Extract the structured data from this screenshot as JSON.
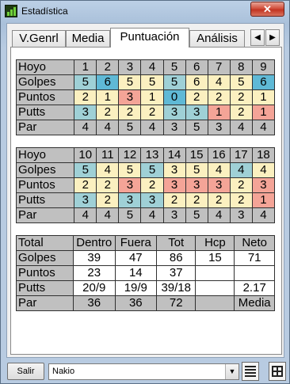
{
  "window": {
    "title": "Estadística",
    "close_symbol": "✕"
  },
  "tabs": [
    "V.Genrl",
    "Media",
    "Puntuación",
    "Análisis"
  ],
  "tab_arrows": {
    "left": "◀",
    "right": "▶"
  },
  "holes_front": {
    "rows": [
      {
        "label": "Hoyo",
        "values": [
          "1",
          "2",
          "3",
          "4",
          "5",
          "6",
          "7",
          "8",
          "9"
        ],
        "colors": [
          "gray",
          "gray",
          "gray",
          "gray",
          "gray",
          "gray",
          "gray",
          "gray",
          "gray"
        ]
      },
      {
        "label": "Golpes",
        "values": [
          "5",
          "6",
          "5",
          "5",
          "5",
          "6",
          "4",
          "5",
          "6"
        ],
        "colors": [
          "blue",
          "teal",
          "yellow",
          "yellow",
          "blue",
          "yellow",
          "yellow",
          "yellow",
          "teal"
        ]
      },
      {
        "label": "Puntos",
        "values": [
          "2",
          "1",
          "3",
          "1",
          "0",
          "2",
          "2",
          "2",
          "1"
        ],
        "colors": [
          "yellow",
          "yellow",
          "red",
          "yellow",
          "teal",
          "yellow",
          "yellow",
          "yellow",
          "yellow"
        ]
      },
      {
        "label": "Putts",
        "values": [
          "3",
          "2",
          "2",
          "2",
          "3",
          "3",
          "1",
          "2",
          "1"
        ],
        "colors": [
          "blue",
          "yellow",
          "yellow",
          "yellow",
          "blue",
          "blue",
          "red",
          "yellow",
          "red"
        ]
      },
      {
        "label": "Par",
        "values": [
          "4",
          "4",
          "5",
          "4",
          "3",
          "5",
          "3",
          "4",
          "4"
        ],
        "colors": [
          "gray",
          "gray",
          "gray",
          "gray",
          "gray",
          "gray",
          "gray",
          "gray",
          "gray"
        ]
      }
    ]
  },
  "holes_back": {
    "rows": [
      {
        "label": "Hoyo",
        "values": [
          "10",
          "11",
          "12",
          "13",
          "14",
          "15",
          "16",
          "17",
          "18"
        ],
        "colors": [
          "gray",
          "gray",
          "gray",
          "gray",
          "gray",
          "gray",
          "gray",
          "gray",
          "gray"
        ]
      },
      {
        "label": "Golpes",
        "values": [
          "5",
          "4",
          "5",
          "5",
          "3",
          "5",
          "4",
          "4",
          "4"
        ],
        "colors": [
          "blue",
          "yellow",
          "yellow",
          "blue",
          "yellow",
          "yellow",
          "yellow",
          "blue",
          "yellow"
        ]
      },
      {
        "label": "Puntos",
        "values": [
          "2",
          "2",
          "3",
          "2",
          "3",
          "3",
          "3",
          "2",
          "3"
        ],
        "colors": [
          "yellow",
          "yellow",
          "red",
          "yellow",
          "red",
          "red",
          "red",
          "yellow",
          "red"
        ]
      },
      {
        "label": "Putts",
        "values": [
          "3",
          "2",
          "3",
          "3",
          "2",
          "2",
          "2",
          "2",
          "1"
        ],
        "colors": [
          "blue",
          "yellow",
          "blue",
          "blue",
          "yellow",
          "yellow",
          "yellow",
          "yellow",
          "red"
        ]
      },
      {
        "label": "Par",
        "values": [
          "4",
          "4",
          "5",
          "4",
          "3",
          "5",
          "4",
          "3",
          "4"
        ],
        "colors": [
          "gray",
          "gray",
          "gray",
          "gray",
          "gray",
          "gray",
          "gray",
          "gray",
          "gray"
        ]
      }
    ]
  },
  "totals": {
    "rows": [
      {
        "label": "Total",
        "values": [
          "Dentro",
          "Fuera",
          "Tot",
          "Hcp",
          "Neto"
        ],
        "colors": [
          "gray",
          "gray",
          "gray",
          "gray",
          "gray"
        ]
      },
      {
        "label": "Golpes",
        "values": [
          "39",
          "47",
          "86",
          "15",
          "71"
        ],
        "colors": [
          "white",
          "white",
          "white",
          "white",
          "white"
        ]
      },
      {
        "label": "Puntos",
        "values": [
          "23",
          "14",
          "37",
          "",
          ""
        ],
        "colors": [
          "white",
          "white",
          "white",
          "white",
          "white"
        ]
      },
      {
        "label": "Putts",
        "values": [
          "20/9",
          "19/9",
          "39/18",
          "",
          "2.17"
        ],
        "colors": [
          "white",
          "white",
          "white",
          "white",
          "white"
        ]
      },
      {
        "label": "Par",
        "values": [
          "36",
          "36",
          "72",
          "",
          "Media"
        ],
        "colors": [
          "gray",
          "gray",
          "gray",
          "gray",
          "gray"
        ]
      }
    ]
  },
  "bottom": {
    "exit_label": "Salir",
    "player": "Nakio",
    "dropdown_symbol": "▼"
  },
  "palette": {
    "gray": "#c0c0c0",
    "blue": "#9fd0d6",
    "teal": "#5fb9d6",
    "yellow": "#fbf0c0",
    "red": "#f4a497",
    "white": "#ffffff"
  }
}
